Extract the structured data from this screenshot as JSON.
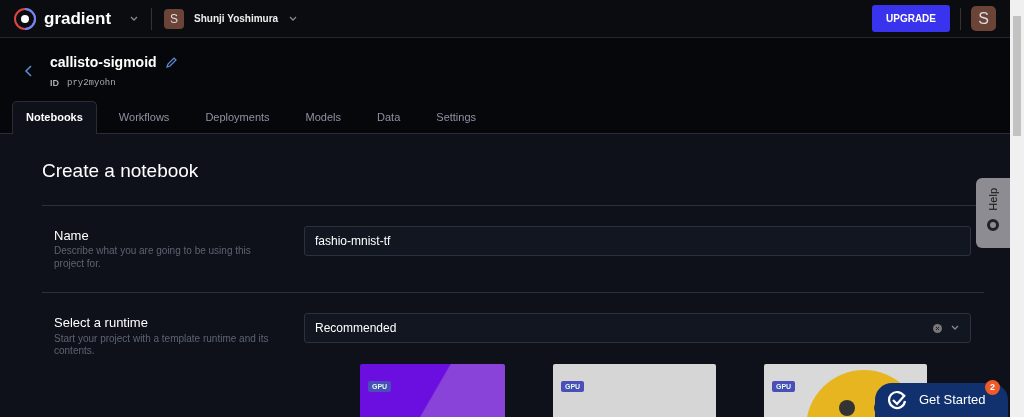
{
  "topbar": {
    "brand": "gradient",
    "workspace_avatar": "S",
    "workspace_user": "Shunji Yoshimura",
    "upgrade": "UPGRADE",
    "profile_avatar": "S"
  },
  "project": {
    "name": "callisto-sigmoid",
    "id_label": "ID",
    "id": "pry2myohn"
  },
  "tabs": [
    {
      "label": "Notebooks",
      "selected": true
    },
    {
      "label": "Workflows",
      "selected": false
    },
    {
      "label": "Deployments",
      "selected": false
    },
    {
      "label": "Models",
      "selected": false
    },
    {
      "label": "Data",
      "selected": false
    },
    {
      "label": "Settings",
      "selected": false
    }
  ],
  "form": {
    "title": "Create a notebook",
    "name_field": {
      "label": "Name",
      "description": "Describe what you are going to be using this project for.",
      "value": "fashio-mnist-tf"
    },
    "runtime_field": {
      "label": "Select a runtime",
      "description": "Start your project with a template runtime and its contents.",
      "value": "Recommended"
    },
    "runtime_cards": [
      {
        "kind": "gradient",
        "badge": "GPU"
      },
      {
        "kind": "plain",
        "badge": "GPU"
      },
      {
        "kind": "emoji",
        "badge": "GPU"
      }
    ]
  },
  "help_tab": {
    "label": "Help"
  },
  "get_started": {
    "label": "Get Started",
    "count": "2"
  }
}
